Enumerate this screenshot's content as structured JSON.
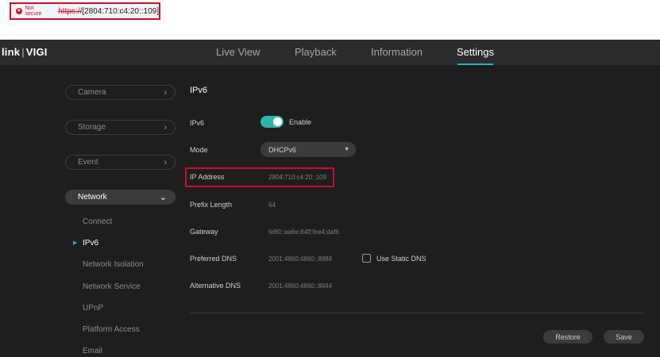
{
  "browser": {
    "security_label": "Not secure",
    "url_scheme": "https://",
    "url_rest": "[2804:710:c4:20::109]",
    "highlight_color": "#c8102e"
  },
  "header": {
    "logo_brand": "link",
    "logo_separator": "|",
    "logo_product": "VIGI",
    "tabs": [
      {
        "label": "Live View"
      },
      {
        "label": "Playback"
      },
      {
        "label": "Information"
      },
      {
        "label": "Settings",
        "active": true
      }
    ],
    "accent_color": "#2fb5a8"
  },
  "sidebar": {
    "groups": [
      {
        "label": "Camera",
        "icon": "chevron-right-icon"
      },
      {
        "label": "Storage",
        "icon": "chevron-right-icon"
      },
      {
        "label": "Event",
        "icon": "chevron-right-icon"
      },
      {
        "label": "Network",
        "icon": "chevron-down-icon",
        "expanded": true
      }
    ],
    "network_items": [
      {
        "label": "Connect"
      },
      {
        "label": "IPv6",
        "active": true
      },
      {
        "label": "Network Isolation"
      },
      {
        "label": "Network Service"
      },
      {
        "label": "UPnP"
      },
      {
        "label": "Platform Access"
      },
      {
        "label": "Email"
      }
    ]
  },
  "main": {
    "title": "IPv6",
    "ipv6_label": "IPv6",
    "ipv6_toggle_label": "Enable",
    "ipv6_enabled": true,
    "mode_label": "Mode",
    "mode_value": "DHCPv6",
    "ip_label": "IP Address",
    "ip_value": "2804:710:c4:20::109",
    "prefix_label": "Prefix Length",
    "prefix_value": "64",
    "gateway_label": "Gateway",
    "gateway_value": "fe80::aa6e:84ff:fee4:daf6",
    "pref_dns_label": "Preferred DNS",
    "pref_dns_value": "2001:4860:4860::8888",
    "static_dns_label": "Use Static DNS",
    "static_dns_checked": false,
    "alt_dns_label": "Alternative DNS",
    "alt_dns_value": "2001:4860:4860::8844",
    "restore_label": "Restore",
    "save_label": "Save"
  }
}
